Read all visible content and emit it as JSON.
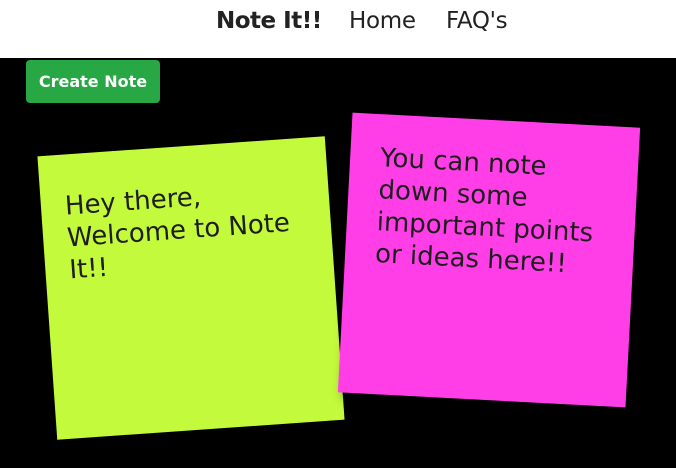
{
  "navbar": {
    "brand": "Note It!!",
    "links": [
      {
        "label": "Home"
      },
      {
        "label": "FAQ's"
      }
    ]
  },
  "toolbar": {
    "create_label": "Create Note",
    "create_color": "#28a745"
  },
  "notes": [
    {
      "text": "Hey there, Welcome to Note It!!",
      "color": "#c4fa3c"
    },
    {
      "text": "You can note down some important points or ideas here!!",
      "color": "#ff3ee8"
    }
  ]
}
